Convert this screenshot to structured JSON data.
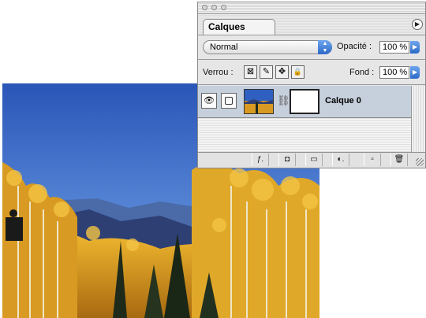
{
  "palette": {
    "tab_label": "Calques",
    "menu_glyph": "▶",
    "blend_mode": "Normal",
    "opacity_label": "Opacité :",
    "opacity_value": "100 %",
    "lock_label": "Verrou :",
    "fill_label": "Fond :",
    "fill_value": "100 %",
    "lock_icons": [
      "transparency-lock-icon",
      "brush-lock-icon",
      "move-lock-icon",
      "padlock-icon"
    ],
    "lock_glyphs": [
      "⊠",
      "✎",
      "✥",
      "🔒"
    ],
    "layer": {
      "name": "Calque 0",
      "eye_glyph": "👁",
      "link_glyph": "⛓"
    },
    "footer_glyphs": [
      "ƒ.",
      "◘",
      "▭",
      "◐.",
      "▫",
      "🗑"
    ],
    "footer_icons": [
      "layer-style-icon",
      "add-mask-icon",
      "new-set-icon",
      "adjustment-layer-icon",
      "new-layer-icon",
      "trash-icon"
    ]
  },
  "colors": {
    "sky_top": "#2a55b8",
    "sky_bottom": "#9fc3ee",
    "foliage": "#e0a020",
    "accent_blue": "#2c69c8"
  }
}
